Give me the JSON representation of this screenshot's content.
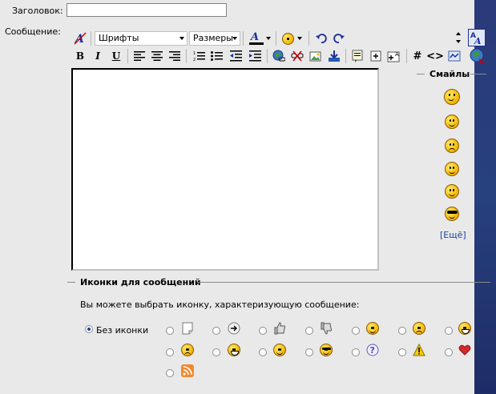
{
  "form": {
    "title_label": "Заголовок:",
    "message_label": "Сообщение:",
    "title_value": ""
  },
  "toolbar": {
    "font_select": "Шрифты",
    "size_select": "Размеры",
    "bold": "B",
    "italic": "I",
    "underline": "U",
    "hash": "#",
    "code": "<>"
  },
  "smilies": {
    "header": "Смайлы",
    "more": "[Ещё]"
  },
  "post_icons": {
    "header": "Иконки для сообщений",
    "description": "Вы можете выбрать иконку, характеризующую сообщение:",
    "none_label": "Без иконки"
  },
  "colors": {
    "accent": "#1c3ea0",
    "strip": "#27407e"
  }
}
